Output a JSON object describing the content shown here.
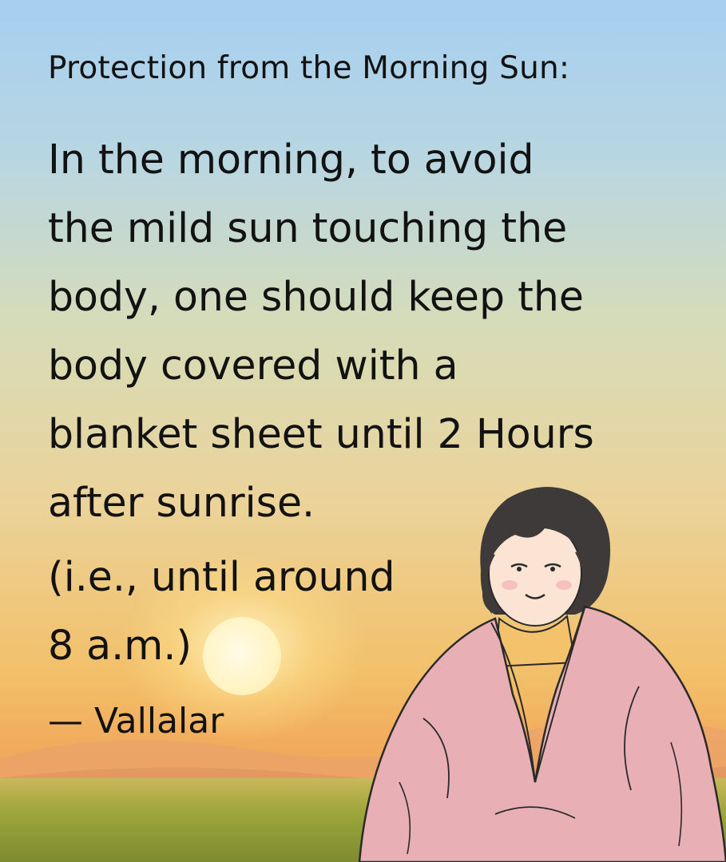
{
  "heading": "Protection from the Morning Sun:",
  "body_lines": [
    "In the morning, to avoid",
    "the mild sun touching the",
    "body, one should keep the",
    "body covered with a",
    "blanket sheet until 2 Hours",
    "after sunrise."
  ],
  "note_lines": [
    "(i.e., until around",
    "8 a.m.)"
  ],
  "attribution": "— Vallalar",
  "colors": {
    "sky_top": "#a6cff0",
    "sky_bottom": "#f1a85a",
    "blanket": "#e8b0b4",
    "text": "#121212"
  }
}
